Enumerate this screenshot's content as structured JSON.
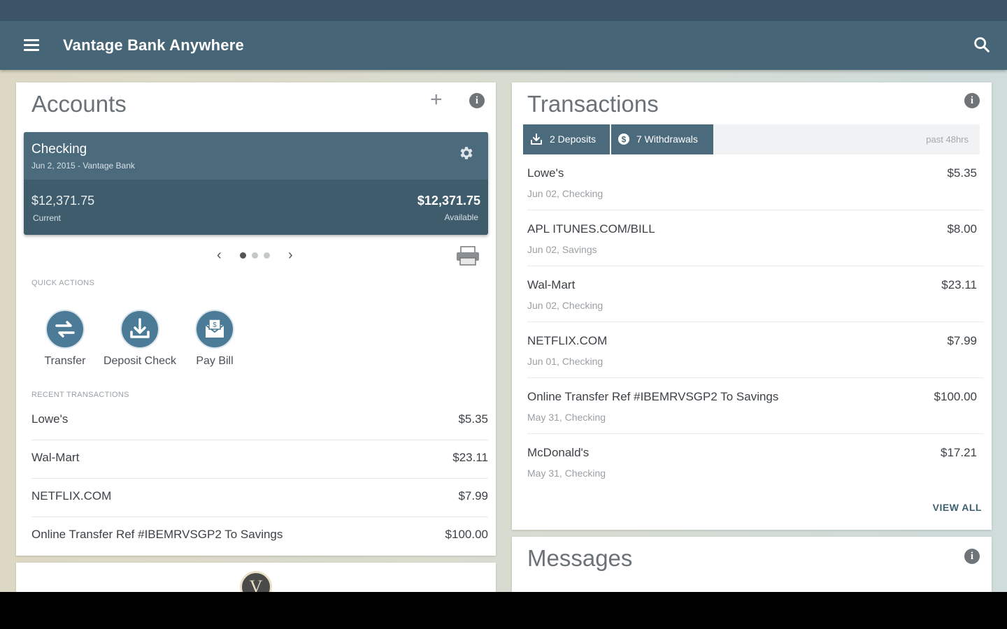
{
  "app": {
    "title": "Vantage Bank Anywhere"
  },
  "accounts": {
    "title": "Accounts",
    "account": {
      "name": "Checking",
      "subtitle": "Jun 2, 2015 - Vantage Bank",
      "current_balance": "$12,371.75",
      "current_label": "Current",
      "available_balance": "$12,371.75",
      "available_label": "Available"
    },
    "pager": {
      "pages": 3,
      "active": 1
    },
    "quick_actions_label": "QUICK ACTIONS",
    "quick_actions": [
      "Transfer",
      "Deposit Check",
      "Pay Bill"
    ],
    "recent_label": "RECENT TRANSACTIONS",
    "recent": [
      {
        "name": "Lowe's",
        "amount": "$5.35"
      },
      {
        "name": "Wal-Mart",
        "amount": "$23.11"
      },
      {
        "name": "NETFLIX.COM",
        "amount": "$7.99"
      },
      {
        "name": "Online Transfer Ref #IBEMRVSGP2 To Savings",
        "amount": "$100.00"
      }
    ]
  },
  "logo": {
    "letter": "V"
  },
  "transactions": {
    "title": "Transactions",
    "filters": {
      "deposits": "2 Deposits",
      "withdrawals": "7 Withdrawals",
      "period": "past 48hrs"
    },
    "items": [
      {
        "name": "Lowe's",
        "date": "Jun 02, Checking",
        "amount": "$5.35"
      },
      {
        "name": "APL ITUNES.COM/BILL",
        "date": "Jun 02, Savings",
        "amount": "$8.00"
      },
      {
        "name": "Wal-Mart",
        "date": "Jun 02, Checking",
        "amount": "$23.11"
      },
      {
        "name": "NETFLIX.COM",
        "date": "Jun 01, Checking",
        "amount": "$7.99"
      },
      {
        "name": "Online Transfer Ref #IBEMRVSGP2 To Savings",
        "date": "May 31, Checking",
        "amount": "$100.00"
      },
      {
        "name": "McDonald's",
        "date": "May 31, Checking",
        "amount": "$17.21"
      }
    ],
    "view_all": "VIEW ALL"
  },
  "messages": {
    "title": "Messages"
  },
  "colors": {
    "appbar": "#466577",
    "statusbar": "#3c5566",
    "accent": "#4b6b7d",
    "action_circle": "#4b7b96"
  }
}
